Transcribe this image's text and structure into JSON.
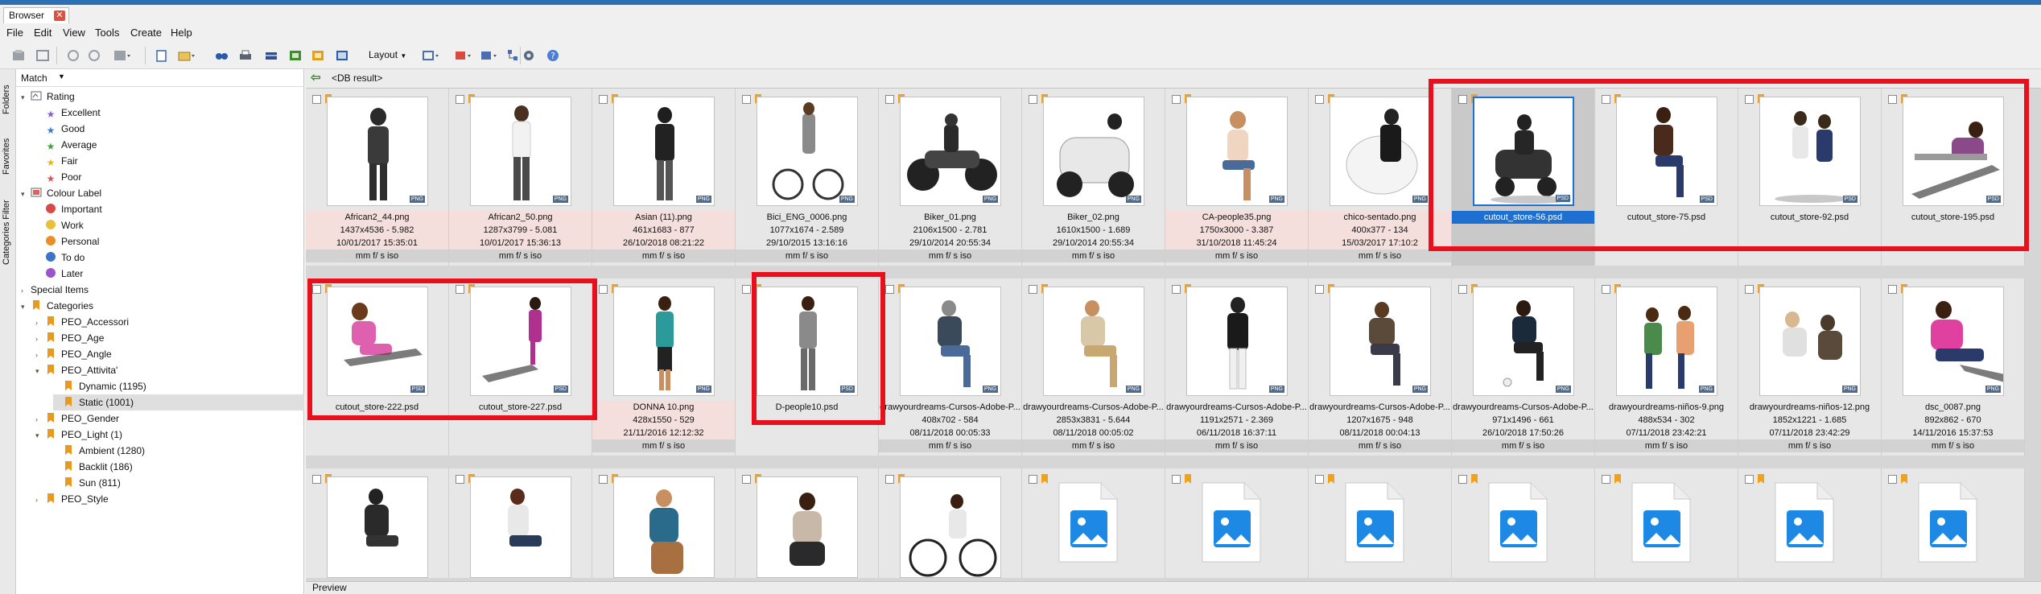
{
  "tab": {
    "title": "Browser"
  },
  "menu": [
    "File",
    "Edit",
    "View",
    "Tools",
    "Create",
    "Help"
  ],
  "toolbar": {
    "layout_label": "Layout"
  },
  "left_panel": {
    "vtabs": [
      "Folders",
      "Favorites",
      "Categories Filter"
    ],
    "match_label": "Match",
    "tree": [
      {
        "label": "Rating",
        "icon": "rating-icon",
        "level": 0,
        "expanded": true
      },
      {
        "label": "Excellent",
        "icon": "star-purple-icon",
        "level": 1
      },
      {
        "label": "Good",
        "icon": "star-blue-icon",
        "level": 1
      },
      {
        "label": "Average",
        "icon": "star-green-icon",
        "level": 1
      },
      {
        "label": "Fair",
        "icon": "star-yellow-icon",
        "level": 1
      },
      {
        "label": "Poor",
        "icon": "star-red-icon",
        "level": 1
      },
      {
        "label": "Colour Label",
        "icon": "colour-label-icon",
        "level": 0,
        "expanded": true
      },
      {
        "label": "Important",
        "icon": "dot-red-icon",
        "level": 1
      },
      {
        "label": "Work",
        "icon": "dot-yellow-icon",
        "level": 1
      },
      {
        "label": "Personal",
        "icon": "dot-orange-icon",
        "level": 1
      },
      {
        "label": "To do",
        "icon": "dot-blue-icon",
        "level": 1
      },
      {
        "label": "Later",
        "icon": "dot-purple-icon",
        "level": 1
      },
      {
        "label": "Special Items",
        "icon": "none",
        "level": 0,
        "expanded": false
      },
      {
        "label": "Categories",
        "icon": "bookmark-icon",
        "level": 0,
        "expanded": true
      },
      {
        "label": "PEO_Accessori",
        "icon": "bookmark-icon",
        "level": 1,
        "expandable": true
      },
      {
        "label": "PEO_Age",
        "icon": "bookmark-icon",
        "level": 1,
        "expandable": true
      },
      {
        "label": "PEO_Angle",
        "icon": "bookmark-icon",
        "level": 1,
        "expandable": true
      },
      {
        "label": "PEO_Attivita'",
        "icon": "bookmark-icon",
        "level": 1,
        "expanded": true
      },
      {
        "label": "Dynamic (1195)",
        "icon": "bookmark-icon",
        "level": 2
      },
      {
        "label": "Static (1001)",
        "icon": "bookmark-icon",
        "level": 2,
        "selected": true
      },
      {
        "label": "PEO_Gender",
        "icon": "bookmark-icon",
        "level": 1,
        "expandable": true
      },
      {
        "label": "PEO_Light (1)",
        "icon": "bookmark-icon",
        "level": 1,
        "expanded": true
      },
      {
        "label": "Ambient (1280)",
        "icon": "bookmark-icon",
        "level": 2
      },
      {
        "label": "Backlit (186)",
        "icon": "bookmark-icon",
        "level": 2
      },
      {
        "label": "Sun (811)",
        "icon": "bookmark-icon",
        "level": 2
      },
      {
        "label": "PEO_Style",
        "icon": "bookmark-icon",
        "level": 1,
        "expandable": true
      }
    ]
  },
  "path": "<DB result>",
  "row1": [
    {
      "name": "African2_44.png",
      "dims": "1437x4536 - 5.982",
      "date": "10/01/2017 15:35:01",
      "exif": "mm f/ s iso",
      "bg": "pink"
    },
    {
      "name": "African2_50.png",
      "dims": "1287x3799 - 5.081",
      "date": "10/01/2017 15:36:13",
      "exif": "mm f/ s iso",
      "bg": "pink"
    },
    {
      "name": "Asian (11).png",
      "dims": "461x1683 - 877",
      "date": "26/10/2018 08:21:22",
      "exif": "mm f/ s iso",
      "bg": "pink"
    },
    {
      "name": "Bici_ENG_0006.png",
      "dims": "1077x1674 - 2.589",
      "date": "29/10/2015 13:16:16",
      "exif": "mm f/ s iso",
      "bg": ""
    },
    {
      "name": "Biker_01.png",
      "dims": "2106x1500 - 2.781",
      "date": "29/10/2014 20:55:34",
      "exif": "mm f/ s iso",
      "bg": ""
    },
    {
      "name": "Biker_02.png",
      "dims": "1610x1500 - 1.689",
      "date": "29/10/2014 20:55:34",
      "exif": "mm f/ s iso",
      "bg": ""
    },
    {
      "name": "CA-people35.png",
      "dims": "1750x3000 - 3.387",
      "date": "31/10/2018 11:45:24",
      "exif": "mm f/ s iso",
      "bg": "pink"
    },
    {
      "name": "chico-sentado.png",
      "dims": "400x377 - 134",
      "date": "15/03/2017 17:10:2",
      "exif": "mm f/ s iso",
      "bg": "pink"
    },
    {
      "name": "cutout_store-56.psd",
      "dims": "",
      "date": "",
      "exif": "",
      "bg": "sel"
    },
    {
      "name": "cutout_store-75.psd",
      "dims": "",
      "date": "",
      "exif": "",
      "bg": ""
    },
    {
      "name": "cutout_store-92.psd",
      "dims": "",
      "date": "",
      "exif": "",
      "bg": ""
    },
    {
      "name": "cutout_store-195.psd",
      "dims": "",
      "date": "",
      "exif": "",
      "bg": ""
    }
  ],
  "row2": [
    {
      "name": "cutout_store-222.psd",
      "dims": "",
      "date": "",
      "exif": "",
      "bg": ""
    },
    {
      "name": "cutout_store-227.psd",
      "dims": "",
      "date": "",
      "exif": "",
      "bg": ""
    },
    {
      "name": "DONNA 10.png",
      "dims": "428x1550 - 529",
      "date": "21/11/2016 12:12:32",
      "exif": "mm f/ s iso",
      "bg": "pink"
    },
    {
      "name": "D-people10.psd",
      "dims": "",
      "date": "",
      "exif": "",
      "bg": ""
    },
    {
      "name": "drawyourdreams-Cursos-Adobe-P...",
      "dims": "408x702 - 584",
      "date": "08/11/2018 00:05:33",
      "exif": "mm f/ s iso",
      "bg": ""
    },
    {
      "name": "drawyourdreams-Cursos-Adobe-P...",
      "dims": "2853x3831 - 5.644",
      "date": "08/11/2018 00:05:02",
      "exif": "mm f/ s iso",
      "bg": ""
    },
    {
      "name": "drawyourdreams-Cursos-Adobe-P...",
      "dims": "1191x2571 - 2.369",
      "date": "06/11/2018 16:37:11",
      "exif": "mm f/ s iso",
      "bg": ""
    },
    {
      "name": "drawyourdreams-Cursos-Adobe-P...",
      "dims": "1207x1675 - 948",
      "date": "08/11/2018 00:04:13",
      "exif": "mm f/ s iso",
      "bg": ""
    },
    {
      "name": "drawyourdreams-Cursos-Adobe-P...",
      "dims": "971x1496 - 661",
      "date": "26/10/2018 17:50:26",
      "exif": "mm f/ s iso",
      "bg": ""
    },
    {
      "name": "drawyourdreams-niños-9.png",
      "dims": "488x534 - 302",
      "date": "07/11/2018 23:42:21",
      "exif": "mm f/ s iso",
      "bg": ""
    },
    {
      "name": "drawyourdreams-niños-12.png",
      "dims": "1852x1221 - 1.685",
      "date": "07/11/2018 23:42:29",
      "exif": "mm f/ s iso",
      "bg": ""
    },
    {
      "name": "dsc_0087.png",
      "dims": "892x862 - 670",
      "date": "14/11/2016 15:37:53",
      "exif": "mm f/ s iso",
      "bg": ""
    }
  ],
  "bottom_panel": {
    "label": "Preview"
  },
  "colors": {
    "accent": "#1e6fd2",
    "highlight": "#e8101c",
    "pink_row": "#f4dfdc"
  }
}
